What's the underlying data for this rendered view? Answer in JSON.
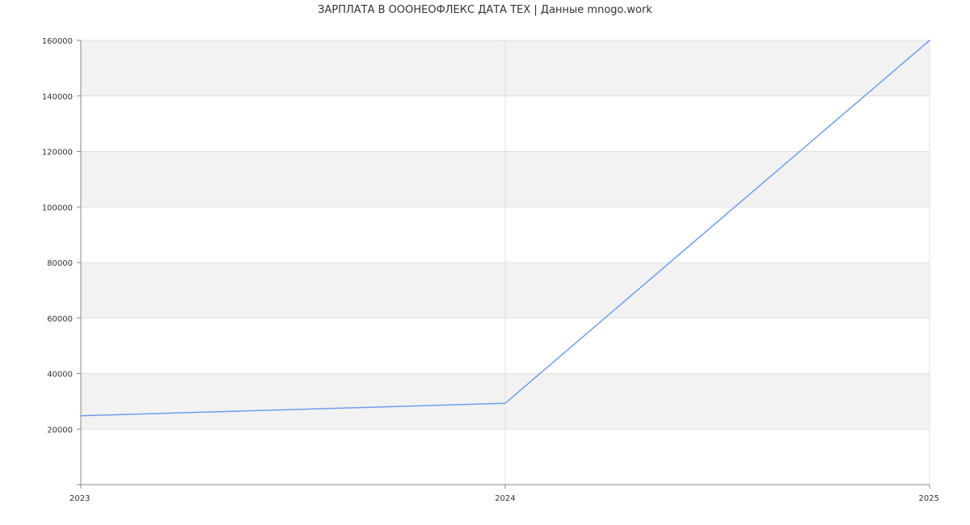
{
  "chart_data": {
    "type": "line",
    "title": "ЗАРПЛАТА В ОООНЕОФЛЕКС ДАТА ТЕХ | Данные mnogo.work",
    "xlabel": "",
    "ylabel": "",
    "x": [
      2023,
      2024,
      2025
    ],
    "x_tick_labels": [
      "2023",
      "2024",
      "2025"
    ],
    "ylim": [
      0,
      160000
    ],
    "y_ticks": [
      20000,
      40000,
      60000,
      80000,
      100000,
      120000,
      140000,
      160000
    ],
    "y_tick_labels": [
      "20000",
      "40000",
      "60000",
      "80000",
      "100000",
      "120000",
      "140000",
      "160000"
    ],
    "series": [
      {
        "values": [
          24800,
          29300,
          160000
        ]
      }
    ],
    "grid": true,
    "colors": {
      "line": "#6d9eeb",
      "band": "#f2f2f2",
      "grid": "#e0e0e0",
      "axis": "#888888",
      "text": "#333333"
    }
  }
}
